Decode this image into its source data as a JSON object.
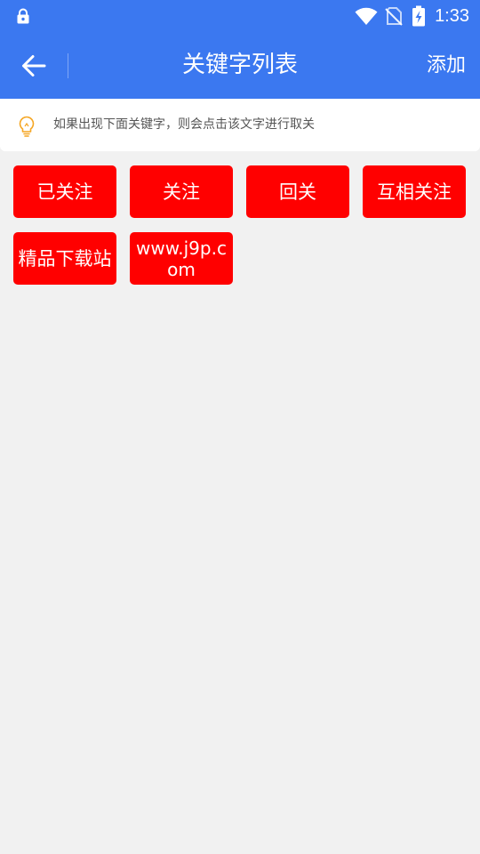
{
  "status_bar": {
    "time": "1:33",
    "icons": [
      "lock-icon",
      "wifi-icon",
      "no-sim-icon",
      "battery-charging-icon"
    ]
  },
  "toolbar": {
    "back_icon": "arrow-left-icon",
    "title": "关键字列表",
    "add_label": "添加"
  },
  "tip": {
    "icon": "lightbulb-icon",
    "text": "如果出现下面关键字，则会点击该文字进行取关"
  },
  "keywords": [
    "已关注",
    "关注",
    "回关",
    "互相关注",
    "精品下载站",
    "www.j9p.com"
  ],
  "colors": {
    "header_bg": "#3b78f0",
    "keyword_bg": "#ff0000",
    "page_bg": "#f1f1f1",
    "tip_icon": "#f5a623"
  }
}
